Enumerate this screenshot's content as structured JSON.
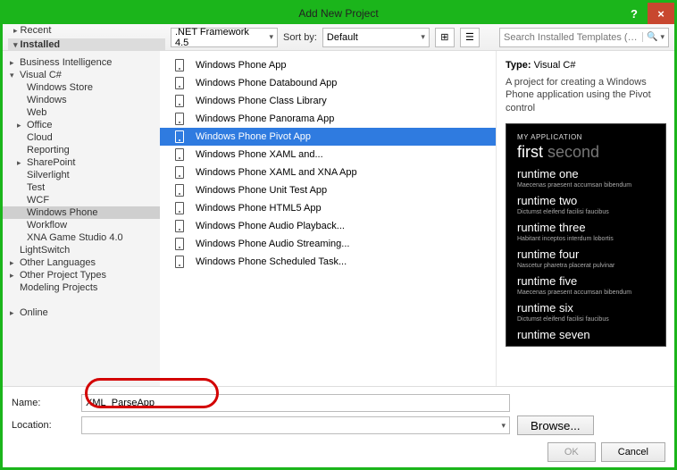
{
  "window": {
    "title": "Add New Project"
  },
  "tabs": {
    "recent": "Recent",
    "installed": "Installed",
    "online": "Online"
  },
  "toolbar": {
    "framework": ".NET Framework 4.5",
    "sortby_label": "Sort by:",
    "sortby_value": "Default",
    "search_placeholder": "Search Installed Templates (Ctrl+E)"
  },
  "tree": [
    {
      "label": "Business Intelligence",
      "level": 0,
      "expand": "closed"
    },
    {
      "label": "Visual C#",
      "level": 0,
      "expand": "open"
    },
    {
      "label": "Windows Store",
      "level": 1,
      "expand": "none"
    },
    {
      "label": "Windows",
      "level": 1,
      "expand": "none"
    },
    {
      "label": "Web",
      "level": 1,
      "expand": "none"
    },
    {
      "label": "Office",
      "level": 1,
      "expand": "closed"
    },
    {
      "label": "Cloud",
      "level": 1,
      "expand": "none"
    },
    {
      "label": "Reporting",
      "level": 1,
      "expand": "none"
    },
    {
      "label": "SharePoint",
      "level": 1,
      "expand": "closed"
    },
    {
      "label": "Silverlight",
      "level": 1,
      "expand": "none"
    },
    {
      "label": "Test",
      "level": 1,
      "expand": "none"
    },
    {
      "label": "WCF",
      "level": 1,
      "expand": "none"
    },
    {
      "label": "Windows Phone",
      "level": 1,
      "expand": "none",
      "selected": true
    },
    {
      "label": "Workflow",
      "level": 1,
      "expand": "none"
    },
    {
      "label": "XNA Game Studio 4.0",
      "level": 1,
      "expand": "none"
    },
    {
      "label": "LightSwitch",
      "level": 0,
      "expand": "none"
    },
    {
      "label": "Other Languages",
      "level": 0,
      "expand": "closed"
    },
    {
      "label": "Other Project Types",
      "level": 0,
      "expand": "closed"
    },
    {
      "label": "Modeling Projects",
      "level": 0,
      "expand": "none"
    }
  ],
  "templates": [
    {
      "label": "Windows Phone App"
    },
    {
      "label": "Windows Phone Databound App"
    },
    {
      "label": "Windows Phone Class Library"
    },
    {
      "label": "Windows Phone Panorama App"
    },
    {
      "label": "Windows Phone Pivot App",
      "selected": true
    },
    {
      "label": "Windows Phone XAML and..."
    },
    {
      "label": "Windows Phone XAML and XNA App"
    },
    {
      "label": "Windows Phone Unit Test App"
    },
    {
      "label": "Windows Phone HTML5 App"
    },
    {
      "label": "Windows Phone Audio Playback..."
    },
    {
      "label": "Windows Phone Audio Streaming..."
    },
    {
      "label": "Windows Phone Scheduled Task..."
    }
  ],
  "right": {
    "type_label": "Type:",
    "type_value": "Visual C#",
    "description": "A project for creating a Windows Phone application using the Pivot control",
    "preview": {
      "appname": "MY APPLICATION",
      "pivot_first": "first",
      "pivot_second": "second",
      "items": [
        {
          "title": "runtime one",
          "sub": "Maecenas praesent accumsan bibendum"
        },
        {
          "title": "runtime two",
          "sub": "Dictumst eleifend facilisi faucibus"
        },
        {
          "title": "runtime three",
          "sub": "Habitant inceptos interdum lobortis"
        },
        {
          "title": "runtime four",
          "sub": "Nascetur pharetra placerat pulvinar"
        },
        {
          "title": "runtime five",
          "sub": "Maecenas praesent accumsan bibendum"
        },
        {
          "title": "runtime six",
          "sub": "Dictumst eleifend facilisi faucibus"
        },
        {
          "title": "runtime seven",
          "sub": ""
        }
      ]
    }
  },
  "form": {
    "name_label": "Name:",
    "name_value": "XML_ParseApp",
    "location_label": "Location:",
    "location_value": "",
    "browse": "Browse...",
    "ok": "OK",
    "cancel": "Cancel"
  }
}
